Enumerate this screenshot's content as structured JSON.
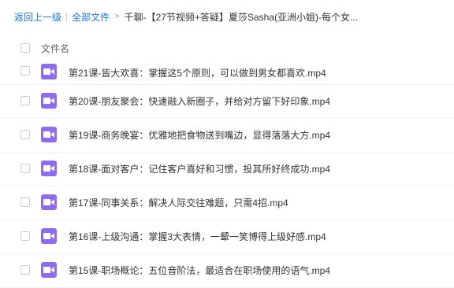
{
  "breadcrumb": {
    "back": "返回上一级",
    "all_files": "全部文件",
    "current": "千聊-【27节视频+答疑】夏莎Sasha(亚洲小姐)-每个女..."
  },
  "header": {
    "column_name": "文件名"
  },
  "files": [
    {
      "name": "第21课-皆大欢喜：掌握这5个原则，可以做到男女都喜欢.mp4",
      "icon": "video-icon"
    },
    {
      "name": "第20课-朋友聚会：快速融入新圈子，并给对方留下好印象.mp4",
      "icon": "video-icon"
    },
    {
      "name": "第19课-商务晚宴：优雅地把食物送到嘴边，显得落落大方.mp4",
      "icon": "video-icon"
    },
    {
      "name": "第18课-面对客户：记住客户喜好和习惯，投其所好终成功.mp4",
      "icon": "video-icon"
    },
    {
      "name": "第17课-同事关系：解决人际交往难题，只需4招.mp4",
      "icon": "video-icon"
    },
    {
      "name": "第16课-上级沟通：掌握3大表情，一颦一笑博得上级好感.mp4",
      "icon": "video-icon"
    },
    {
      "name": "第15课-职场概论：五位音阶法，最适合在职场使用的语气.mp4",
      "icon": "video-icon"
    }
  ],
  "colors": {
    "link": "#1a73e8",
    "video_icon": "#8e6cf0"
  }
}
